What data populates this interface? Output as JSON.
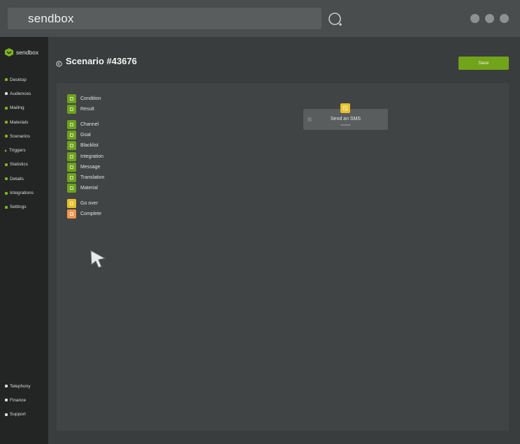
{
  "browser": {
    "url": "sendbox"
  },
  "sidebar": {
    "logo": "sendbox",
    "items": [
      {
        "label": "Desktop"
      },
      {
        "label": "Audiences"
      },
      {
        "label": "Mailing"
      },
      {
        "label": "Materials"
      },
      {
        "label": "Scenarios"
      },
      {
        "label": "Triggers"
      },
      {
        "label": "Statistics"
      },
      {
        "label": "Details"
      },
      {
        "label": "Integrations"
      },
      {
        "label": "Settings"
      }
    ],
    "bottom_items": [
      {
        "label": "Telephony"
      },
      {
        "label": "Finance"
      },
      {
        "label": "Support"
      }
    ]
  },
  "page": {
    "title": "Scenario #43676",
    "save_label": "Save"
  },
  "palette": {
    "items": [
      {
        "label": "Condition",
        "color": "#6ea21d"
      },
      {
        "label": "Result",
        "color": "#6ea21d"
      },
      {
        "label": "Channel",
        "color": "#6ea21d"
      },
      {
        "label": "Goal",
        "color": "#6ea21d"
      },
      {
        "label": "Blacklist",
        "color": "#6ea21d"
      },
      {
        "label": "Integration",
        "color": "#6ea21d"
      },
      {
        "label": "Message",
        "color": "#6ea21d"
      },
      {
        "label": "Translation",
        "color": "#6ea21d"
      },
      {
        "label": "Material",
        "color": "#6ea21d"
      },
      {
        "label": "Go over",
        "color": "#e6c02a"
      },
      {
        "label": "Complete",
        "color": "#ee9651"
      }
    ]
  },
  "node": {
    "title": "Send an SMS",
    "subtitle": "sendsms"
  },
  "colors": {
    "accent": "#72a41b",
    "yellow": "#e6c02a",
    "orange": "#ee9651"
  }
}
